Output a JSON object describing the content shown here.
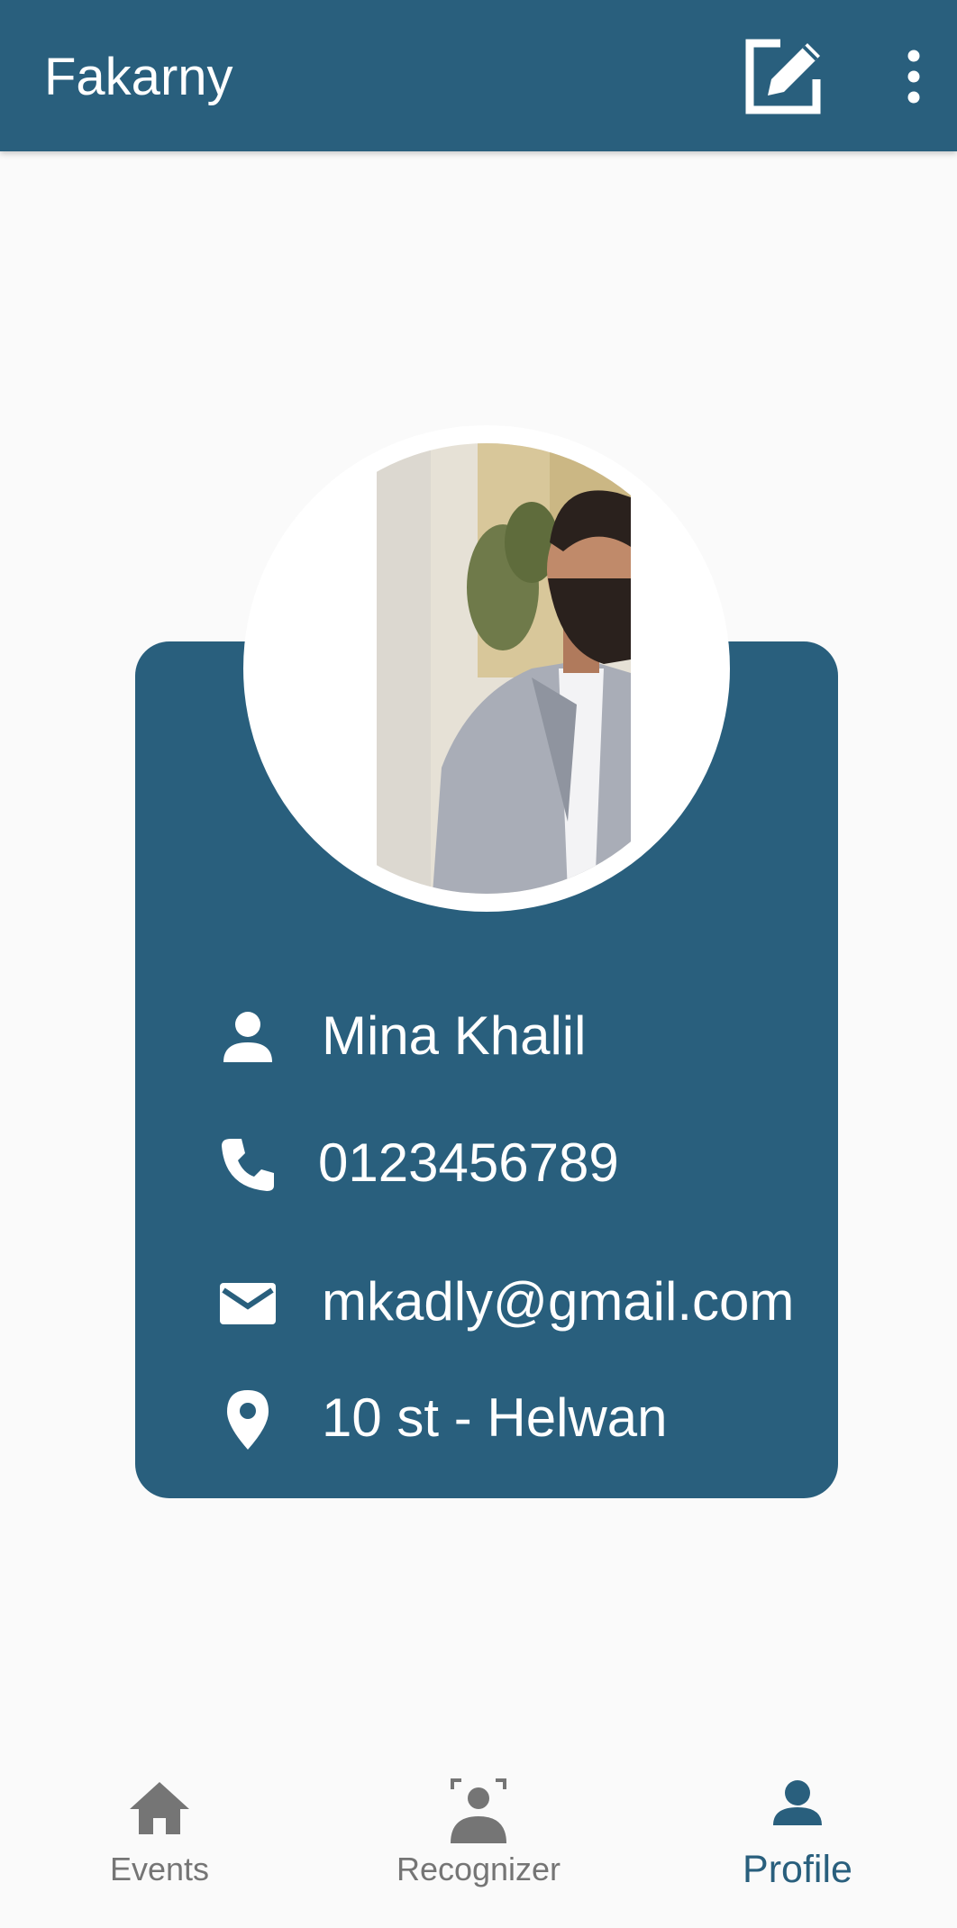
{
  "app_bar": {
    "title": "Fakarny",
    "edit_icon": "edit-square-icon",
    "more_icon": "more-vert-icon"
  },
  "profile": {
    "name": "Mina Khalil",
    "phone": "0123456789",
    "email": "mkadly@gmail.com",
    "address": "10 st - Helwan"
  },
  "bottom_nav": {
    "items": [
      {
        "label": "Events",
        "icon": "home-icon",
        "active": false
      },
      {
        "label": "Recognizer",
        "icon": "face-recognizer-icon",
        "active": false
      },
      {
        "label": "Profile",
        "icon": "person-icon",
        "active": true
      }
    ]
  },
  "colors": {
    "primary": "#295f7d",
    "background": "#fafafa",
    "inactive": "#757575",
    "on_primary": "#ffffff"
  }
}
